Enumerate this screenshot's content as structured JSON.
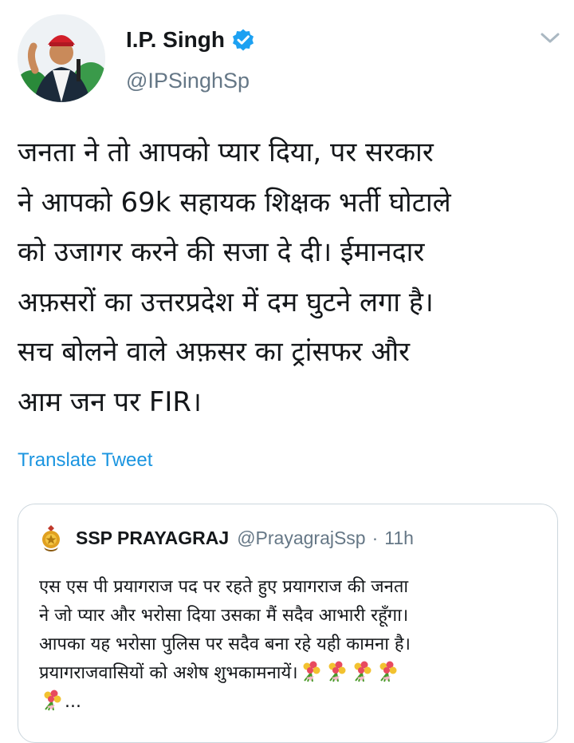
{
  "tweet": {
    "author": {
      "display_name": "I.P. Singh",
      "handle": "@IPSinghSp",
      "verified": true
    },
    "text_lines": [
      "जनता ने तो आपको प्यार दिया, पर सरकार",
      "ने आपको 69k सहायक शिक्षक भर्ती घोटाले",
      "को उजागर करने की सजा दे दी। ईमानदार",
      "अफ़सरों का उत्तरप्रदेश में दम घुटने लगा है।",
      "सच बोलने वाले अफ़सर का ट्रांसफर और",
      "आम जन पर FIR।"
    ],
    "translate_label": "Translate Tweet"
  },
  "quoted_tweet": {
    "display_name": "SSP PRAYAGRAJ",
    "handle": "@PrayagrajSsp",
    "separator": "·",
    "time": "11h",
    "text_lines": [
      "एस एस पी प्रयागराज पद पर रहते हुए प्रयागराज की जनता",
      "ने जो प्यार और भरोसा दिया उसका मैं सदैव आभारी रहूँगा।",
      "आपका यह भरोसा पुलिस पर सदैव बना रहे यही कामना है।",
      "प्रयागराजवासियों को अशेष शुभकामनायें।"
    ],
    "ellipsis": "...",
    "emoji_name": "bouquet-emoji"
  },
  "colors": {
    "link": "#1b95e0",
    "verified": "#1da1f2",
    "muted": "#657786",
    "border": "#ccd6dd"
  }
}
